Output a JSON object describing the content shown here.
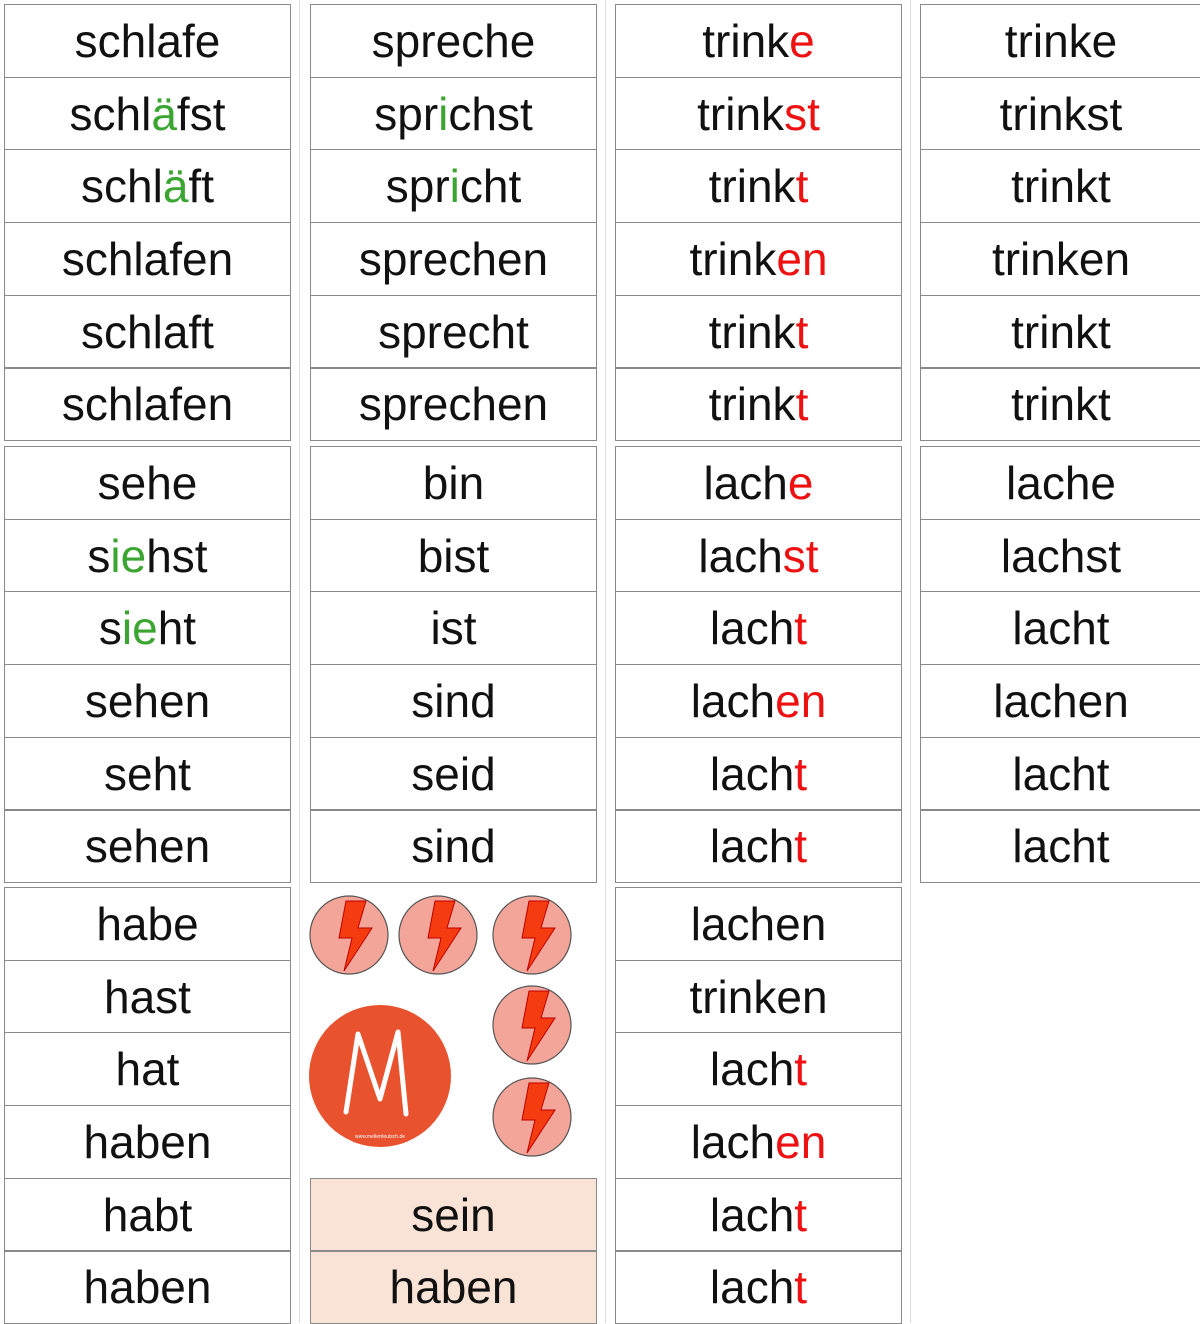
{
  "colors": {
    "green": "#3aa530",
    "red": "#ee1111",
    "tan": "#f9e3d7",
    "logo": "#e8522e",
    "bolt_circle": "#f4a59a",
    "bolt": "#f53c10"
  },
  "blocks": [
    [
      [
        [
          [
            "schlafe"
          ]
        ],
        [
          [
            "schl"
          ],
          [
            "ä",
            "g"
          ],
          [
            "fst"
          ]
        ],
        [
          [
            "schl"
          ],
          [
            "ä",
            "g"
          ],
          [
            "ft"
          ]
        ],
        [
          [
            "schlafen"
          ]
        ],
        [
          [
            "schlaft"
          ]
        ],
        [
          [
            "schlafen"
          ]
        ]
      ],
      [
        [
          [
            "spreche"
          ]
        ],
        [
          [
            "spr"
          ],
          [
            "i",
            "g"
          ],
          [
            "chst"
          ]
        ],
        [
          [
            "spr"
          ],
          [
            "i",
            "g"
          ],
          [
            "cht"
          ]
        ],
        [
          [
            "sprechen"
          ]
        ],
        [
          [
            "sprecht"
          ]
        ],
        [
          [
            "sprechen"
          ]
        ]
      ],
      [
        [
          [
            "trink"
          ],
          [
            "e",
            "r"
          ]
        ],
        [
          [
            "trink"
          ],
          [
            "st",
            "r"
          ]
        ],
        [
          [
            "trink"
          ],
          [
            "t",
            "r"
          ]
        ],
        [
          [
            "trink"
          ],
          [
            "en",
            "r"
          ]
        ],
        [
          [
            "trink"
          ],
          [
            "t",
            "r"
          ]
        ],
        [
          [
            "trink"
          ],
          [
            "t",
            "r"
          ]
        ]
      ],
      [
        [
          [
            "trinke"
          ]
        ],
        [
          [
            "trinkst"
          ]
        ],
        [
          [
            "trinkt"
          ]
        ],
        [
          [
            "trinken"
          ]
        ],
        [
          [
            "trinkt"
          ]
        ],
        [
          [
            "trinkt"
          ]
        ]
      ]
    ],
    [
      [
        [
          [
            "sehe"
          ]
        ],
        [
          [
            "s"
          ],
          [
            "ie",
            "g"
          ],
          [
            "hst"
          ]
        ],
        [
          [
            "s"
          ],
          [
            "ie",
            "g"
          ],
          [
            "ht"
          ]
        ],
        [
          [
            "sehen"
          ]
        ],
        [
          [
            "seht"
          ]
        ],
        [
          [
            "sehen"
          ]
        ]
      ],
      [
        [
          [
            "bin"
          ]
        ],
        [
          [
            "bist"
          ]
        ],
        [
          [
            "ist"
          ]
        ],
        [
          [
            "sind"
          ]
        ],
        [
          [
            "seid"
          ]
        ],
        [
          [
            "sind"
          ]
        ]
      ],
      [
        [
          [
            "lach"
          ],
          [
            "e",
            "r"
          ]
        ],
        [
          [
            "lach"
          ],
          [
            "st",
            "r"
          ]
        ],
        [
          [
            "lach"
          ],
          [
            "t",
            "r"
          ]
        ],
        [
          [
            "lach"
          ],
          [
            "en",
            "r"
          ]
        ],
        [
          [
            "lach"
          ],
          [
            "t",
            "r"
          ]
        ],
        [
          [
            "lach"
          ],
          [
            "t",
            "r"
          ]
        ]
      ],
      [
        [
          [
            "lache"
          ]
        ],
        [
          [
            "lachst"
          ]
        ],
        [
          [
            "lacht"
          ]
        ],
        [
          [
            "lachen"
          ]
        ],
        [
          [
            "lacht"
          ]
        ],
        [
          [
            "lacht"
          ]
        ]
      ]
    ],
    [
      [
        [
          [
            "habe"
          ]
        ],
        [
          [
            "hast"
          ]
        ],
        [
          [
            "hat"
          ]
        ],
        [
          [
            "haben"
          ]
        ],
        [
          [
            "habt"
          ]
        ],
        [
          [
            "haben"
          ]
        ]
      ],
      [
        null,
        null,
        null,
        null,
        [
          [
            "sein"
          ]
        ],
        [
          [
            "haben"
          ]
        ]
      ],
      [
        [
          [
            "lachen"
          ]
        ],
        [
          [
            "trinken"
          ]
        ],
        [
          [
            "lach"
          ],
          [
            "t",
            "r"
          ]
        ],
        [
          [
            "lach"
          ],
          [
            "en",
            "r"
          ]
        ],
        [
          [
            "lach"
          ],
          [
            "t",
            "r"
          ]
        ],
        [
          [
            "lach"
          ],
          [
            "t",
            "r"
          ]
        ]
      ],
      []
    ]
  ],
  "logo": {
    "letter": "M",
    "url": "www.mellerdeutsch.de"
  },
  "icons": [
    "lightning-icon",
    "lightning-icon",
    "lightning-icon",
    "lightning-icon",
    "lightning-icon"
  ]
}
